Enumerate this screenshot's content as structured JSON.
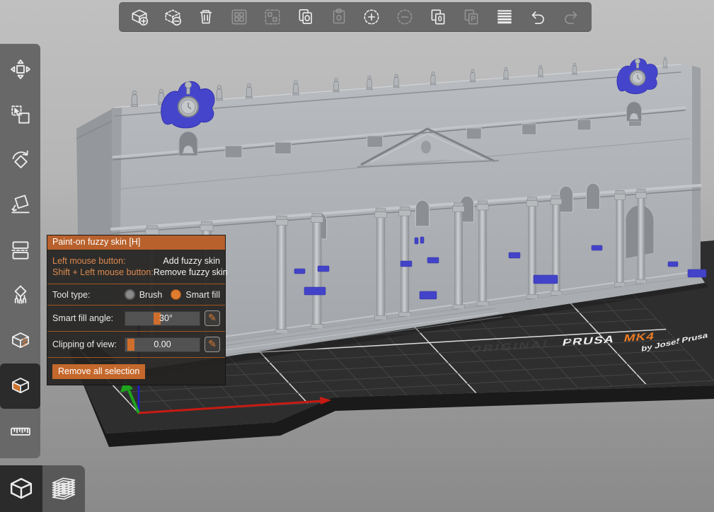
{
  "toolbar": {
    "items": [
      {
        "name": "add-object",
        "enabled": true
      },
      {
        "name": "delete-object",
        "enabled": true
      },
      {
        "name": "delete-all",
        "enabled": true
      },
      {
        "name": "arrange",
        "enabled": false
      },
      {
        "name": "arrange-selection",
        "enabled": false
      },
      {
        "name": "copy",
        "enabled": true
      },
      {
        "name": "paste",
        "enabled": false
      },
      {
        "name": "add-instance",
        "enabled": true
      },
      {
        "name": "remove-instance",
        "enabled": false
      },
      {
        "name": "split-to-objects",
        "enabled": true
      },
      {
        "name": "split-to-parts",
        "enabled": false
      },
      {
        "name": "variable-layer-height",
        "enabled": true
      },
      {
        "name": "undo",
        "enabled": true
      },
      {
        "name": "redo",
        "enabled": false
      }
    ]
  },
  "sidebar": {
    "tools": [
      {
        "name": "move",
        "active": false
      },
      {
        "name": "scale",
        "active": false
      },
      {
        "name": "rotate",
        "active": false
      },
      {
        "name": "place-on-face",
        "active": false
      },
      {
        "name": "cut",
        "active": false
      },
      {
        "name": "paint-on-supports",
        "active": false
      },
      {
        "name": "seam-painting",
        "active": false
      },
      {
        "name": "paint-on-fuzzy-skin",
        "active": true
      },
      {
        "name": "measure",
        "active": false
      }
    ]
  },
  "view_toggles": [
    {
      "name": "3d-editor",
      "active": true
    },
    {
      "name": "sliced-preview",
      "active": false
    }
  ],
  "panel": {
    "title": "Paint-on fuzzy skin [H]",
    "shortcuts": [
      {
        "label": "Left mouse button:",
        "action": "Add fuzzy skin"
      },
      {
        "label": "Shift + Left mouse button:",
        "action": "Remove fuzzy skin"
      }
    ],
    "tool_type": {
      "label": "Tool type:",
      "options": [
        {
          "label": "Brush",
          "selected": false
        },
        {
          "label": "Smart fill",
          "selected": true
        }
      ]
    },
    "sliders": [
      {
        "label": "Smart fill angle:",
        "value": "30°",
        "fraction": 0.38
      },
      {
        "label": "Clipping of view:",
        "value": "0.00",
        "fraction": 0.03
      }
    ],
    "remove_button": "Remove all selection"
  },
  "bed": {
    "brand_prefix": "ORIGINAL",
    "brand_name": "PRUSA",
    "brand_model": "MK4",
    "byline": "by Josef Prusa"
  },
  "colors": {
    "accent": "#c9682c",
    "paint_blue": "#4343c9",
    "bed": "#2e2e2e",
    "model_gray": "#b0b3b6"
  }
}
